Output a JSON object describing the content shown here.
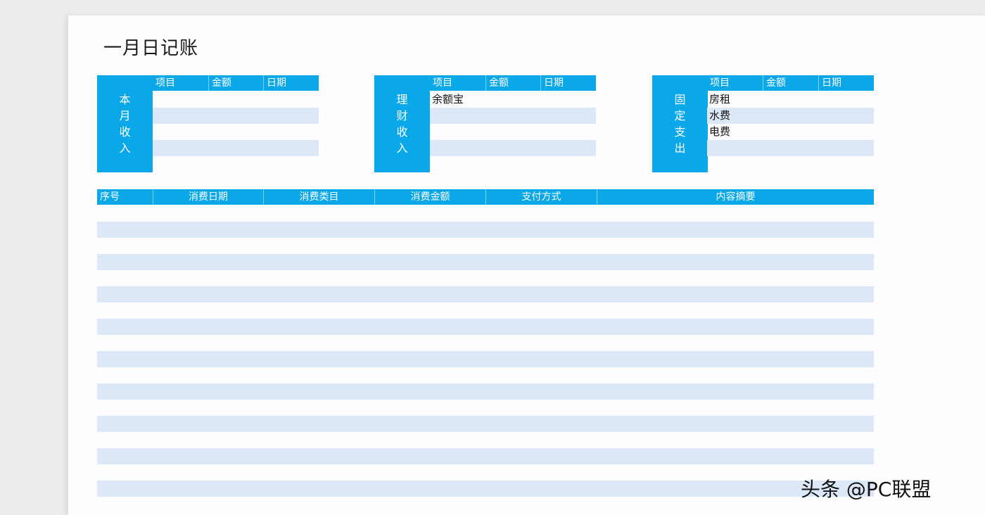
{
  "title": "一月日记账",
  "sections": [
    {
      "side_label": [
        "本",
        "月",
        "收",
        "入"
      ],
      "headers": [
        "项目",
        "金额",
        "日期"
      ],
      "items": [
        "",
        "",
        "",
        ""
      ]
    },
    {
      "side_label": [
        "理",
        "财",
        "收",
        "入"
      ],
      "headers": [
        "项目",
        "金额",
        "日期"
      ],
      "items": [
        "余额宝",
        "",
        "",
        ""
      ]
    },
    {
      "side_label": [
        "固",
        "定",
        "支",
        "出"
      ],
      "headers": [
        "项目",
        "金额",
        "日期"
      ],
      "items": [
        "房租",
        "水费",
        "电费",
        ""
      ]
    }
  ],
  "ledger": {
    "headers": [
      "序号",
      "消费日期",
      "消费类目",
      "消费金额",
      "支付方式",
      "内容摘要"
    ]
  },
  "watermark": "头条 @PC联盟",
  "colors": {
    "header_blue": "#0aa8e8",
    "stripe": "#dce8f7"
  }
}
